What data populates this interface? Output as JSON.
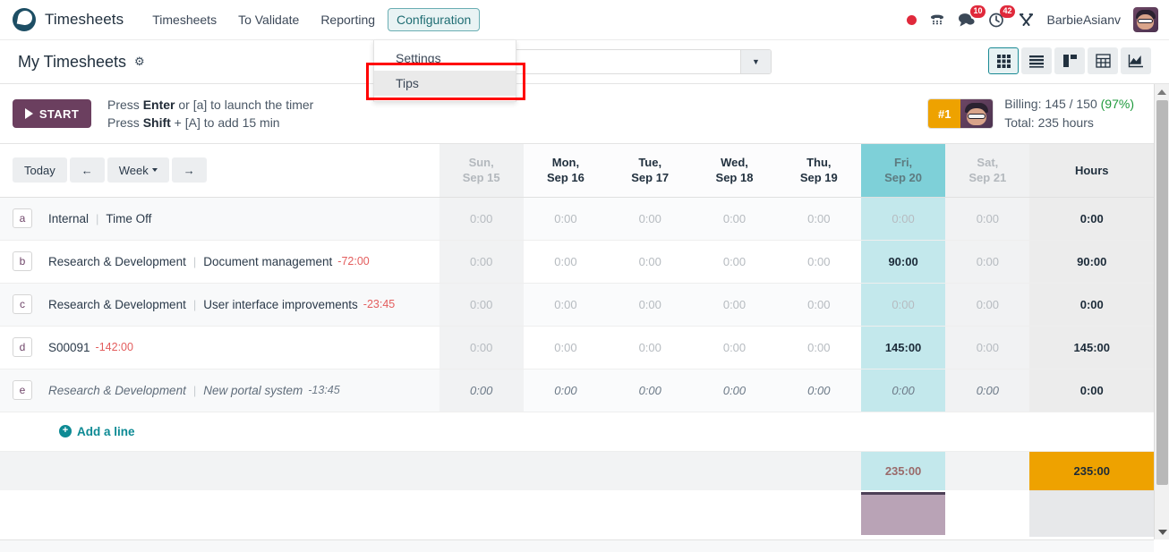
{
  "navbar": {
    "brand": "Timesheets",
    "brand_logo_icon": "odoo-logo-icon",
    "items": [
      {
        "label": "Timesheets",
        "active": false
      },
      {
        "label": "To Validate",
        "active": false
      },
      {
        "label": "Reporting",
        "active": false
      },
      {
        "label": "Configuration",
        "active": true
      }
    ],
    "right": {
      "recording_icon": "record-dot-icon",
      "phone_icon": "dialpad-icon",
      "messages_icon": "chat-bubble-icon",
      "messages_count": "10",
      "activities_icon": "clock-activity-icon",
      "activities_count": "42",
      "tools_icon": "wrench-tools-icon",
      "username": "BarbieAsianv",
      "avatar_icon": "user-avatar-icon"
    }
  },
  "dropdown": {
    "open_for": "Configuration",
    "items": [
      {
        "label": "Settings",
        "highlighted": false
      },
      {
        "label": "Tips",
        "highlighted": true
      }
    ],
    "annotation_color": "#ff0000"
  },
  "control_panel": {
    "title": "My Timesheets",
    "settings_icon": "gear-icon",
    "search": {
      "value": "",
      "placeholder": ""
    },
    "search_toggle_icon": "chevron-down-icon",
    "views": [
      {
        "icon": "grid-view-icon",
        "active": true
      },
      {
        "icon": "list-view-icon",
        "active": false
      },
      {
        "icon": "kanban-view-icon",
        "active": false
      },
      {
        "icon": "pivot-view-icon",
        "active": false
      },
      {
        "icon": "graph-view-icon",
        "active": false
      }
    ]
  },
  "timer": {
    "start_label": "START",
    "play_icon": "play-icon",
    "hint_line1_pre": "Press ",
    "hint_line1_key": "Enter",
    "hint_line1_post": " or [a] to launch the timer",
    "hint_line2_pre": "Press ",
    "hint_line2_key": "Shift",
    "hint_line2_post": " + [A] to add 15 min",
    "rank": "#1",
    "rank_avatar_icon": "user-avatar-icon",
    "billing_label": "Billing: 145 / 150 ",
    "billing_pct": "(97%)",
    "billing_pct_color": "#1f9a3d",
    "total_label": "Total: 235 hours"
  },
  "grid": {
    "nav": {
      "today_label": "Today",
      "prev_icon": "arrow-left-icon",
      "period_label": "Week",
      "period_caret_icon": "caret-down-icon",
      "next_icon": "arrow-right-icon"
    },
    "columns": [
      {
        "dow": "Sun,",
        "date": "Sep 15",
        "weekend": true,
        "today": false
      },
      {
        "dow": "Mon,",
        "date": "Sep 16",
        "weekend": false,
        "today": false
      },
      {
        "dow": "Tue,",
        "date": "Sep 17",
        "weekend": false,
        "today": false
      },
      {
        "dow": "Wed,",
        "date": "Sep 18",
        "weekend": false,
        "today": false
      },
      {
        "dow": "Thu,",
        "date": "Sep 19",
        "weekend": false,
        "today": false
      },
      {
        "dow": "Fri,",
        "date": "Sep 20",
        "weekend": false,
        "today": true
      },
      {
        "dow": "Sat,",
        "date": "Sep 21",
        "weekend": true,
        "today": false
      }
    ],
    "hours_header": "Hours",
    "rows": [
      {
        "key": "a",
        "project": "Internal",
        "task": "Time Off",
        "remaining": "",
        "italic": false,
        "values": [
          "0:00",
          "0:00",
          "0:00",
          "0:00",
          "0:00",
          "0:00",
          "0:00"
        ],
        "filled": [
          false,
          false,
          false,
          false,
          false,
          false,
          false
        ],
        "total": "0:00"
      },
      {
        "key": "b",
        "project": "Research & Development",
        "task": "Document management",
        "remaining": "-72:00",
        "italic": false,
        "values": [
          "0:00",
          "0:00",
          "0:00",
          "0:00",
          "0:00",
          "90:00",
          "0:00"
        ],
        "filled": [
          false,
          false,
          false,
          false,
          false,
          true,
          false
        ],
        "total": "90:00"
      },
      {
        "key": "c",
        "project": "Research & Development",
        "task": "User interface improvements",
        "remaining": "-23:45",
        "italic": false,
        "values": [
          "0:00",
          "0:00",
          "0:00",
          "0:00",
          "0:00",
          "0:00",
          "0:00"
        ],
        "filled": [
          false,
          false,
          false,
          false,
          false,
          false,
          false
        ],
        "total": "0:00"
      },
      {
        "key": "d",
        "project": "S00091",
        "task": "",
        "remaining": "-142:00",
        "italic": false,
        "values": [
          "0:00",
          "0:00",
          "0:00",
          "0:00",
          "0:00",
          "145:00",
          "0:00"
        ],
        "filled": [
          false,
          false,
          false,
          false,
          false,
          true,
          false
        ],
        "total": "145:00"
      },
      {
        "key": "e",
        "project": "Research & Development",
        "task": "New portal system",
        "remaining": "-13:45",
        "italic": true,
        "values": [
          "0:00",
          "0:00",
          "0:00",
          "0:00",
          "0:00",
          "0:00",
          "0:00"
        ],
        "filled": [
          false,
          false,
          false,
          false,
          false,
          false,
          false
        ],
        "total": "0:00"
      }
    ],
    "add_line_label": "Add a line",
    "add_line_icon": "plus-circle-icon",
    "totals": {
      "values": [
        "",
        "",
        "",
        "",
        "",
        "235:00",
        ""
      ],
      "grand_total": "235:00",
      "grand_total_bg": "#eea200"
    },
    "bar_chart": {
      "column_index": 5,
      "color": "#b9a3b6",
      "cap_color": "#4c3f56"
    }
  },
  "scrollbar": {
    "up_icon": "scroll-up-arrow-icon",
    "down_icon": "scroll-down-arrow-icon"
  }
}
